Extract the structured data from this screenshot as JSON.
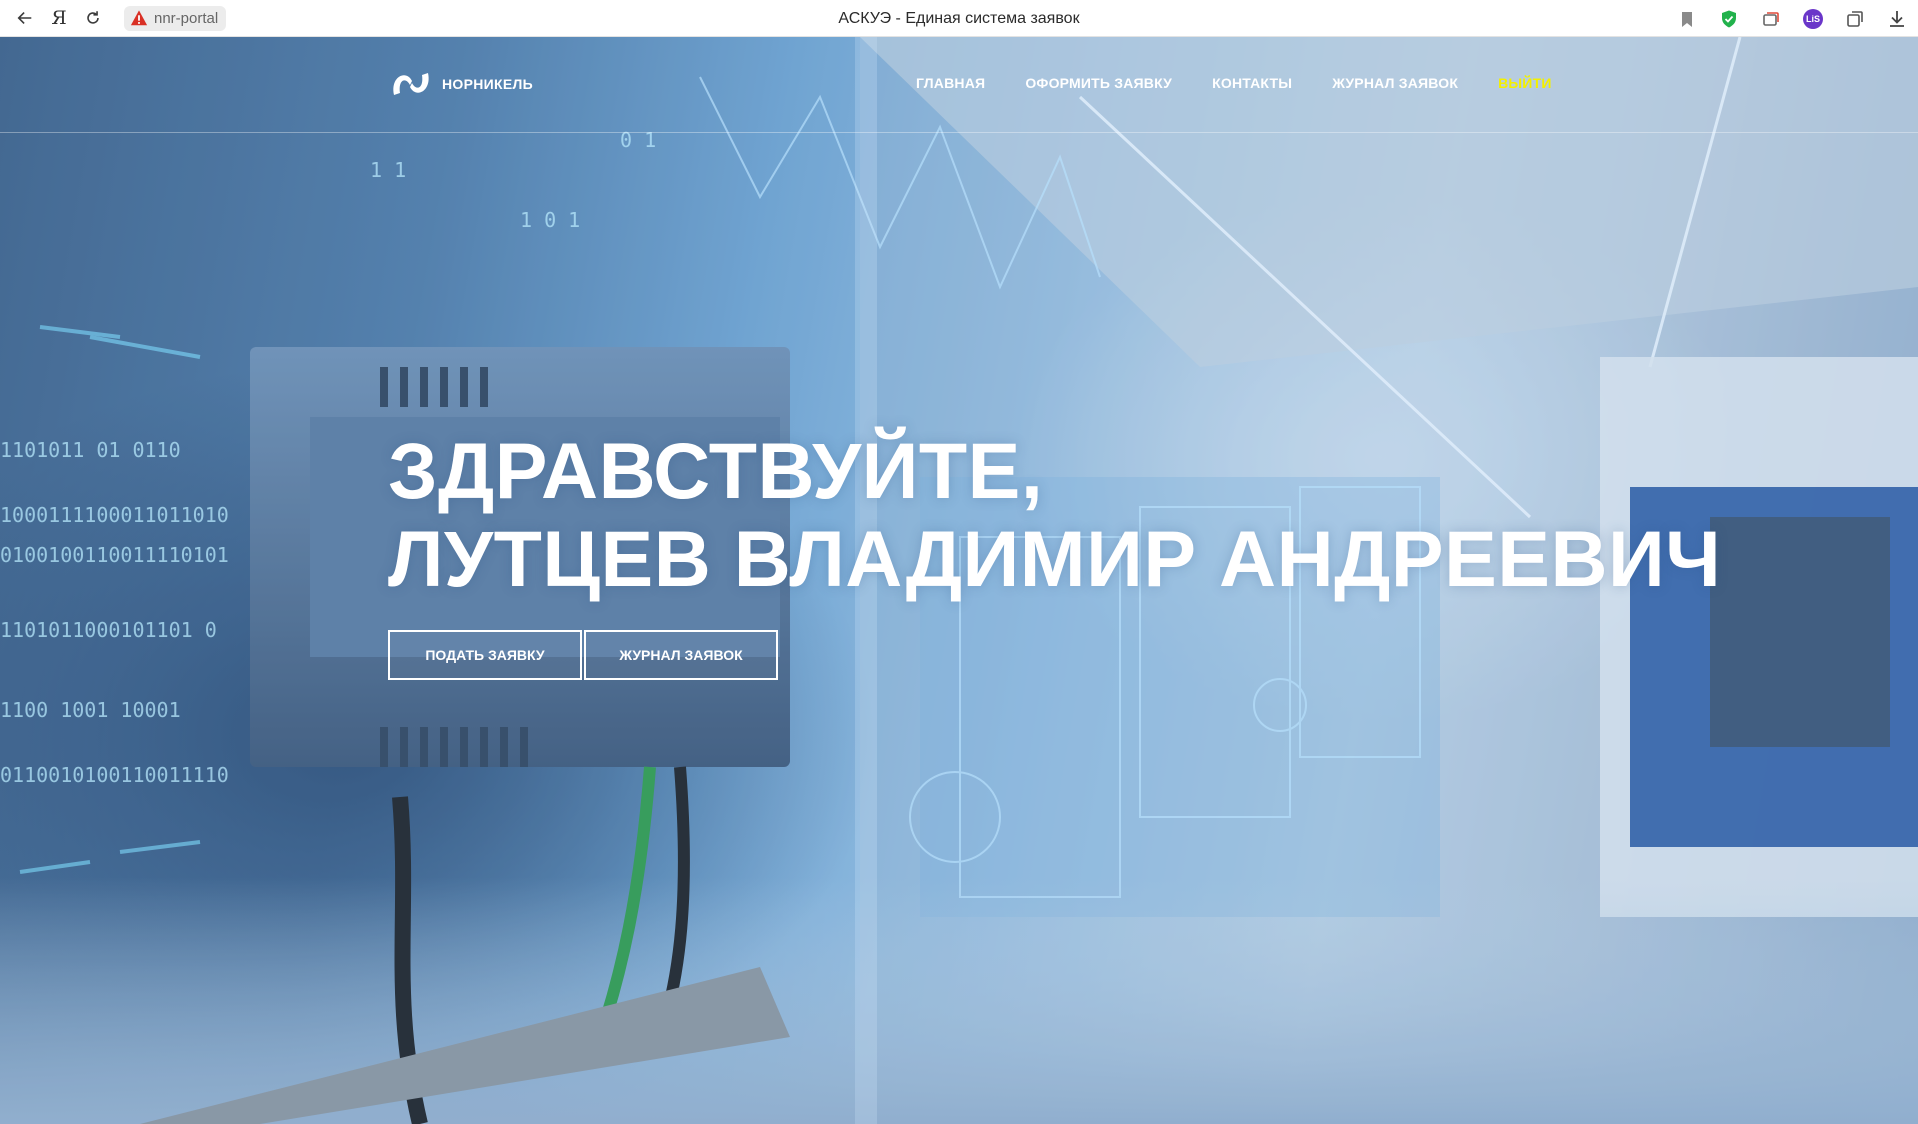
{
  "browser": {
    "url_text": "nnr-portal",
    "window_title": "АСКУЭ - Единая система заявок",
    "yandex_glyph": "Я",
    "profile_initials": "LiS",
    "icons": [
      "back-arrow-icon",
      "yandex-icon",
      "reload-icon",
      "warning-icon",
      "bookmark-icon",
      "shield-check-icon",
      "collections-icon",
      "profile-avatar",
      "tabs-icon",
      "download-icon"
    ]
  },
  "site": {
    "brand_name": "НОРНИКЕЛЬ",
    "menu": [
      {
        "label": "ГЛАВНАЯ"
      },
      {
        "label": "ОФОРМИТЬ ЗАЯВКУ"
      },
      {
        "label": "КОНТАКТЫ"
      },
      {
        "label": "ЖУРНАЛ ЗАЯВОК"
      },
      {
        "label": "ВЫЙТИ"
      }
    ],
    "logout_color": "#f4f000"
  },
  "hero": {
    "line1": "ЗДРАВСТВУЙТЕ,",
    "line2": "ЛУТЦЕВ ВЛАДИМИР АНДРЕЕВИЧ",
    "buttons": [
      {
        "label": "ПОДАТЬ ЗАЯВКУ"
      },
      {
        "label": "ЖУРНАЛ ЗАЯВОК"
      }
    ]
  }
}
